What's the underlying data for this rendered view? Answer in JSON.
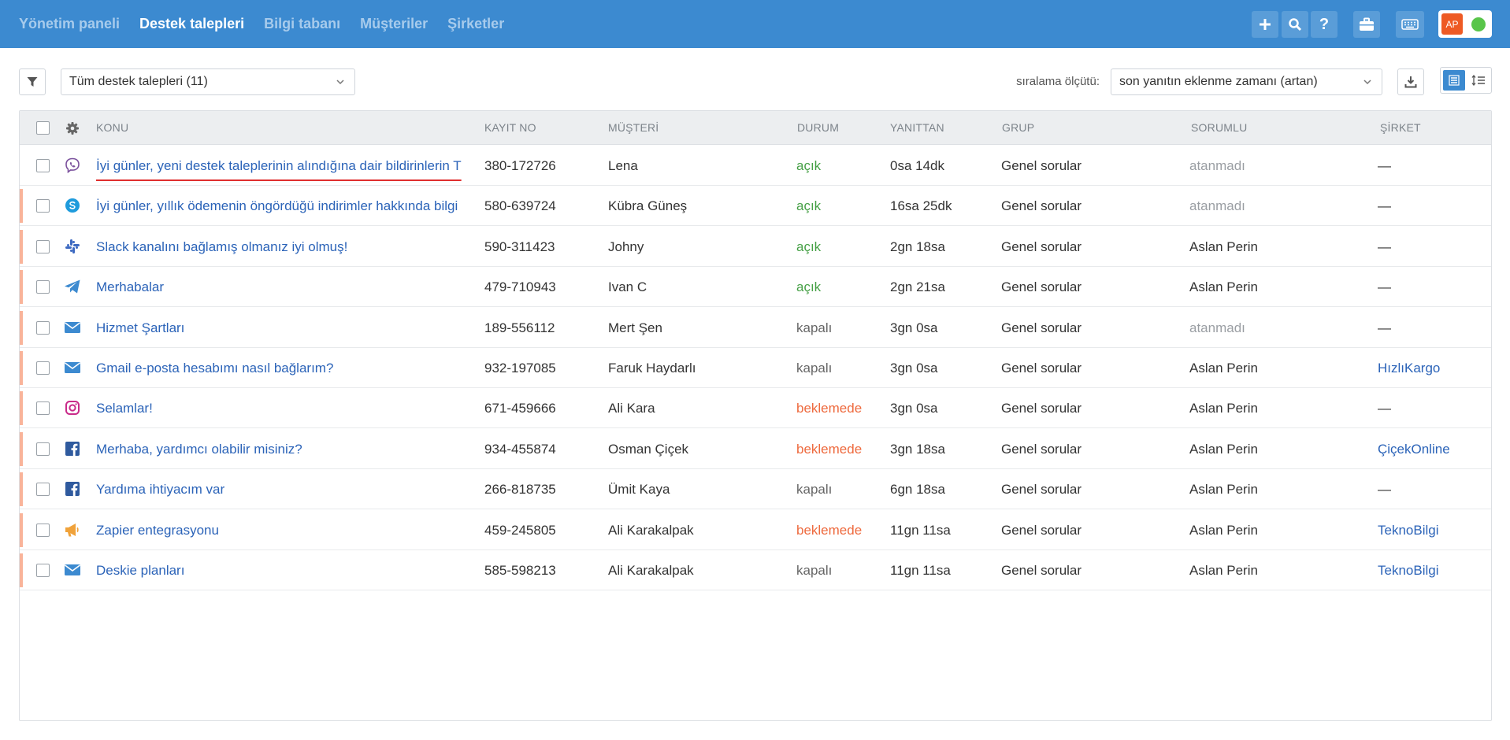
{
  "nav": {
    "items": [
      "Yönetim paneli",
      "Destek talepleri",
      "Bilgi tabanı",
      "Müşteriler",
      "Şirketler"
    ],
    "active_index": 1
  },
  "user": {
    "initials": "AP",
    "status_color": "#58c54a"
  },
  "colors": {
    "header": "#3c8ad0",
    "link": "#2b63b8",
    "open": "#46a046",
    "waiting": "#ee6a3e",
    "accent_bar": "#f9b49a"
  },
  "toolbar": {
    "filter_value": "Tüm destek talepleri (11)",
    "sort_label": "sıralama ölçütü:",
    "sort_value": "son yanıtın eklenme zamanı (artan)"
  },
  "table": {
    "columns": {
      "subject": "KONU",
      "id": "KAYIT NO",
      "customer": "MÜŞTERİ",
      "status": "DURUM",
      "age": "YANITTAN",
      "group": "GRUP",
      "assignee": "SORUMLU",
      "company": "ŞİRKET"
    },
    "rows": [
      {
        "channel": "viber-icon",
        "subject": "İyi günler, yeni destek taleplerinin alındığına dair bildirinlerin T",
        "id": "380-172726",
        "customer": "Lena",
        "status": "açık",
        "age": "0sa 14dk",
        "group": "Genel sorular",
        "assignee": "atanmadı",
        "company": "—"
      },
      {
        "channel": "skype-icon",
        "subject": "İyi günler, yıllık ödemenin öngördüğü indirimler hakkında bilgi",
        "id": "580-639724",
        "customer": "Kübra Güneş",
        "status": "açık",
        "age": "16sa 25dk",
        "group": "Genel sorular",
        "assignee": "atanmadı",
        "company": "—"
      },
      {
        "channel": "slack-icon",
        "subject": "Slack kanalını bağlamış olmanız iyi olmuş!",
        "id": "590-311423",
        "customer": "Johny",
        "status": "açık",
        "age": "2gn 18sa",
        "group": "Genel sorular",
        "assignee": "Aslan Perin",
        "company": "—"
      },
      {
        "channel": "telegram-icon",
        "subject": "Merhabalar",
        "id": "479-710943",
        "customer": "Ivan C",
        "status": "açık",
        "age": "2gn 21sa",
        "group": "Genel sorular",
        "assignee": "Aslan Perin",
        "company": "—"
      },
      {
        "channel": "email-icon",
        "subject": "Hizmet Şartları",
        "id": "189-556112",
        "customer": "Mert Şen",
        "status": "kapalı",
        "age": "3gn 0sa",
        "group": "Genel sorular",
        "assignee": "atanmadı",
        "company": "—"
      },
      {
        "channel": "email-icon",
        "subject": "Gmail e-posta hesabımı nasıl bağlarım?",
        "id": "932-197085",
        "customer": "Faruk Haydarlı",
        "status": "kapalı",
        "age": "3gn 0sa",
        "group": "Genel sorular",
        "assignee": "Aslan Perin",
        "company": "HızlıKargo"
      },
      {
        "channel": "instagram-icon",
        "subject": "Selamlar!",
        "id": "671-459666",
        "customer": "Ali Kara",
        "status": "beklemede",
        "age": "3gn 0sa",
        "group": "Genel sorular",
        "assignee": "Aslan Perin",
        "company": "—"
      },
      {
        "channel": "facebook-icon",
        "subject": "Merhaba, yardımcı olabilir misiniz?",
        "id": "934-455874",
        "customer": "Osman Çiçek",
        "status": "beklemede",
        "age": "3gn 18sa",
        "group": "Genel sorular",
        "assignee": "Aslan Perin",
        "company": "ÇiçekOnline"
      },
      {
        "channel": "facebook-icon",
        "subject": "Yardıma ihtiyacım var",
        "id": "266-818735",
        "customer": "Ümit Kaya",
        "status": "kapalı",
        "age": "6gn 18sa",
        "group": "Genel sorular",
        "assignee": "Aslan Perin",
        "company": "—"
      },
      {
        "channel": "megaphone-icon",
        "subject": "Zapier entegrasyonu",
        "id": "459-245805",
        "customer": "Ali Karakalpak",
        "status": "beklemede",
        "age": "11gn 11sa",
        "group": "Genel sorular",
        "assignee": "Aslan Perin",
        "company": "TeknoBilgi"
      },
      {
        "channel": "email-icon",
        "subject": "Deskie planları",
        "id": "585-598213",
        "customer": "Ali Karakalpak",
        "status": "kapalı",
        "age": "11gn 11sa",
        "group": "Genel sorular",
        "assignee": "Aslan Perin",
        "company": "TeknoBilgi"
      }
    ]
  }
}
